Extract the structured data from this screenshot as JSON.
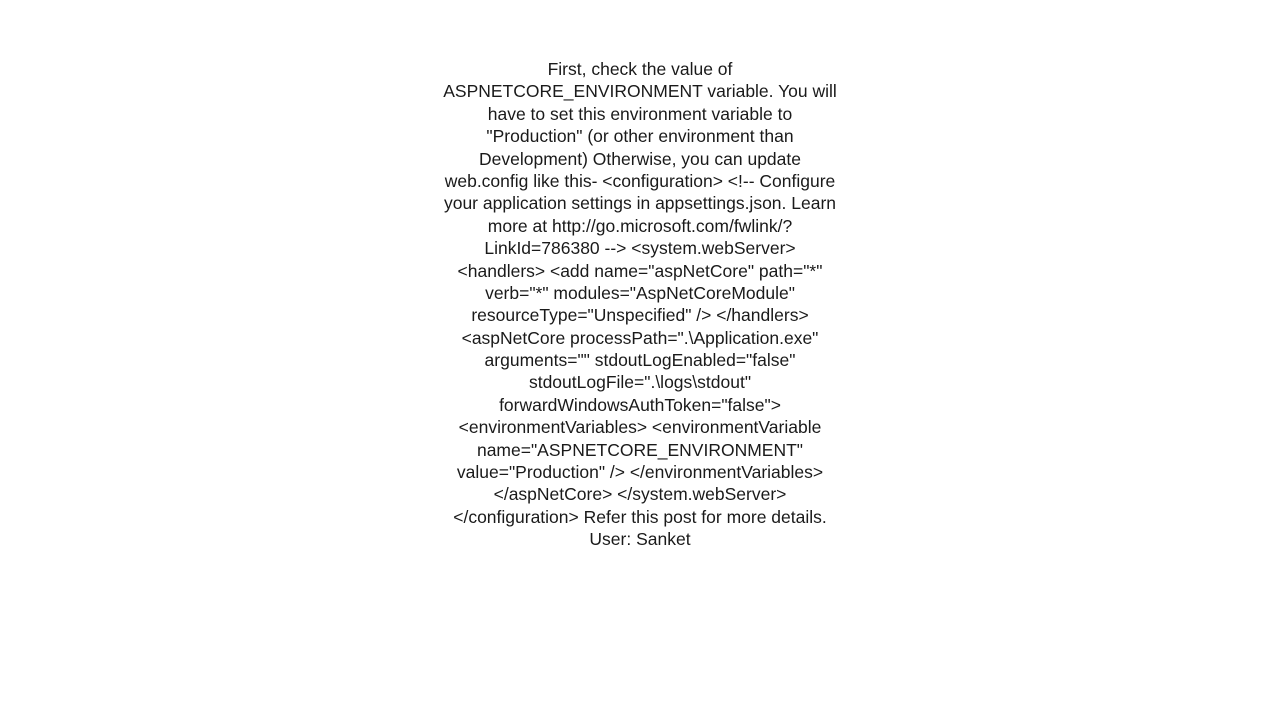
{
  "post": {
    "body": "First, check the value of ASPNETCORE_ENVIRONMENT variable. You will have to set this environment variable to \"Production\" (or other environment than Development) Otherwise, you can update web.config like this-  <configuration>   <!--     Configure your application settings in appsettings.json. Learn more at http://go.microsoft.com/fwlink/?LinkId=786380   -->   <system.webServer>     <handlers>       <add name=\"aspNetCore\" path=\"*\" verb=\"*\" modules=\"AspNetCoreModule\" resourceType=\"Unspecified\" />     </handlers>     <aspNetCore processPath=\".\\Application.exe\" arguments=\"\" stdoutLogEnabled=\"false\" stdoutLogFile=\".\\logs\\stdout\" forwardWindowsAuthToken=\"false\">       <environmentVariables>         <environmentVariable name=\"ASPNETCORE_ENVIRONMENT\" value=\"Production\" />       </environmentVariables>     </aspNetCore>   </system.webServer> </configuration>  Refer this post for more details.  User: Sanket"
  }
}
